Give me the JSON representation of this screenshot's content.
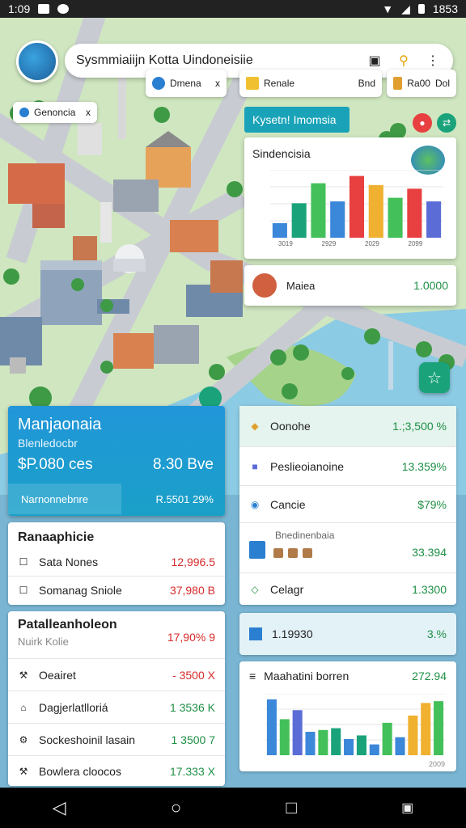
{
  "status": {
    "time": "1:09",
    "battery_text": "1853"
  },
  "search": {
    "title": "Sysmmiaiijn Kotta Uindoneisiie"
  },
  "chips": [
    {
      "label": "Dmena",
      "suffix": "x"
    },
    {
      "label": "Renale",
      "suffix": "Bnd"
    },
    {
      "label": "Ra00",
      "suffix": "Dol"
    },
    {
      "label": "Genoncia",
      "suffix": "x"
    }
  ],
  "map_panel": {
    "header": "Kysetn! Imomsia",
    "title": "Sindencisia",
    "ticks": [
      "3019",
      "2929",
      "2029",
      "2099"
    ]
  },
  "price_card": {
    "label": "Maiea",
    "value": "1.0000"
  },
  "blue_card": {
    "title": "Manjaonaia",
    "subtitle": "Blenledocbr",
    "price": "$P.080 ces",
    "price2": "8.30 Bve",
    "footer_label": "Narnonnebnre",
    "footer_value": "R.5501 29%"
  },
  "left_card1": {
    "title": "Ranaaphicie",
    "rows": [
      {
        "label": "Sata Nones",
        "value": "12,996.5"
      },
      {
        "label": "Somanag Sniole",
        "value": "37,980 B"
      }
    ]
  },
  "left_card2": {
    "title": "Patalleanholeon",
    "subtitle": "Nuirk Kolie",
    "subtitle_value": "17,90% 9",
    "rows": [
      {
        "label": "Oeairet",
        "value": "- 3500 X",
        "color": "#d62b2b"
      },
      {
        "label": "Dagjerlatlloriá",
        "value": "1 3536 K",
        "color": "#1e8f45"
      },
      {
        "label": "Sockeshoinil lasain",
        "value": "1 3500 7",
        "color": "#1e8f45"
      },
      {
        "label": "Bowlera cloocos",
        "value": "17.333 X",
        "color": "#1e8f45"
      }
    ]
  },
  "right_card1": {
    "rows": [
      {
        "label": "Oonohe",
        "value": "1.;3,500 %"
      },
      {
        "label": "Peslieoianoine",
        "value": "13.359%"
      },
      {
        "label": "Cancie",
        "value": "$79%"
      },
      {
        "label": "Bnedinenbaia",
        "value": "33.394"
      },
      {
        "label": "Celagr",
        "value": "1.3300"
      }
    ]
  },
  "right_card2": {
    "label": "1.19930",
    "value": "3.%"
  },
  "right_card3": {
    "title": "Maahatini borren",
    "value": "272.94",
    "tick": "2009"
  },
  "chart_data": [
    {
      "type": "bar",
      "title": "Sindencisia",
      "categories": [
        "3019",
        "2929",
        "2029",
        "2099"
      ],
      "series": [
        {
          "values": [
            16,
            38,
            60,
            40,
            68,
            58,
            44,
            54,
            40
          ]
        }
      ],
      "colors": [
        "#3b87d9",
        "#1aa37a",
        "#43c059",
        "#3b87d9",
        "#e84040",
        "#f0b030",
        "#43c059",
        "#e84040",
        "#5b6cd6"
      ]
    },
    {
      "type": "bar",
      "title": "Maahatini borren",
      "categories": [
        "2009"
      ],
      "series": [
        {
          "values": [
            62,
            40,
            50,
            26,
            28,
            30,
            18,
            22,
            12,
            36,
            20,
            44,
            58,
            60
          ]
        }
      ],
      "colors": [
        "#3b87d9",
        "#43c059",
        "#5b6cd6",
        "#3b87d9",
        "#43c059",
        "#1aa37a",
        "#3b87d9",
        "#1aa37a",
        "#3b87d9",
        "#43c059",
        "#3b87d9",
        "#f0b030",
        "#f0b030",
        "#43c059"
      ]
    }
  ]
}
